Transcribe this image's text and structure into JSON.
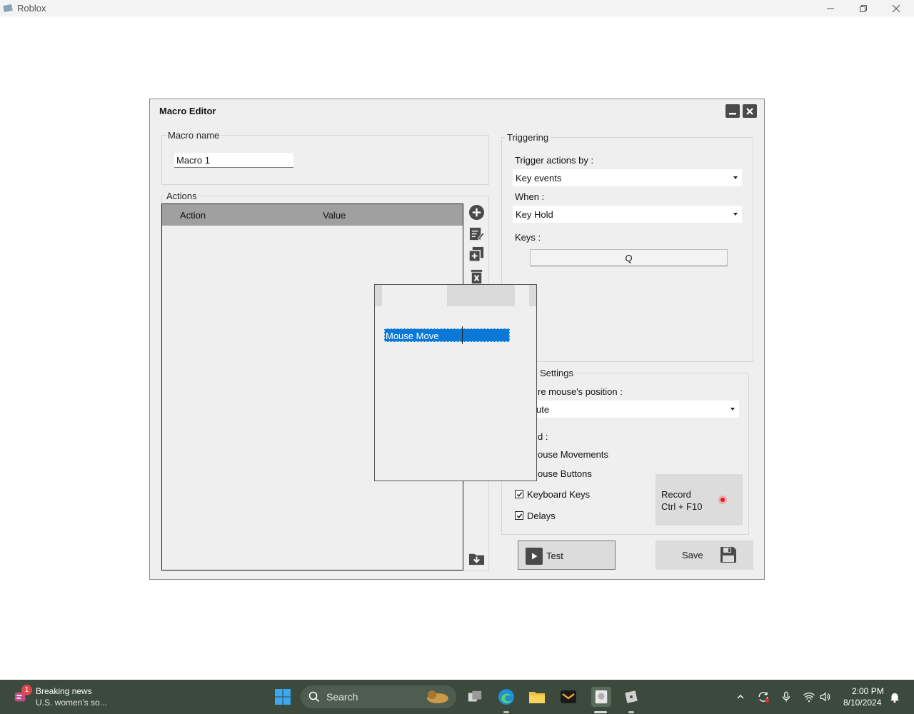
{
  "app_window": {
    "title": "Roblox",
    "controls": [
      "minimize-icon",
      "restore-icon",
      "close-icon"
    ]
  },
  "dialog": {
    "title": "Macro Editor",
    "macro_name_group": "Macro name",
    "macro_name_value": "Macro 1",
    "actions_group": "Actions",
    "columns": {
      "action": "Action",
      "value": "Value"
    },
    "side_icons": [
      "add-icon",
      "edit-icon",
      "duplicate-icon",
      "delete-icon",
      "import-icon"
    ],
    "triggering": {
      "group": "Triggering",
      "trigger_label": "Trigger actions by :",
      "trigger_value": "Key events",
      "when_label": "When :",
      "when_value": "Key Hold",
      "keys_label": "Keys :",
      "keys_value": "Q"
    },
    "settings": {
      "group": "Settings",
      "mouse_position_label": "re mouse's position :",
      "mouse_position_value": "ute",
      "record_label": "d :",
      "options": [
        {
          "label": "ouse Movements",
          "checked": null
        },
        {
          "label": "ouse Buttons",
          "checked": null
        },
        {
          "label": "Keyboard Keys",
          "checked": true
        },
        {
          "label": "Delays",
          "checked": true
        }
      ],
      "record_title": "Record",
      "record_shortcut": "Ctrl + F10"
    },
    "test_label": "Test",
    "save_label": "Save"
  },
  "popup": {
    "selected_item": "Mouse Move"
  },
  "taskbar": {
    "news_badge": "1",
    "news_title": "Breaking news",
    "news_subtitle": "U.S. women's so...",
    "search_placeholder": "Search",
    "time": "2:00 PM",
    "date": "8/10/2024",
    "accent": "#0a78d7"
  }
}
